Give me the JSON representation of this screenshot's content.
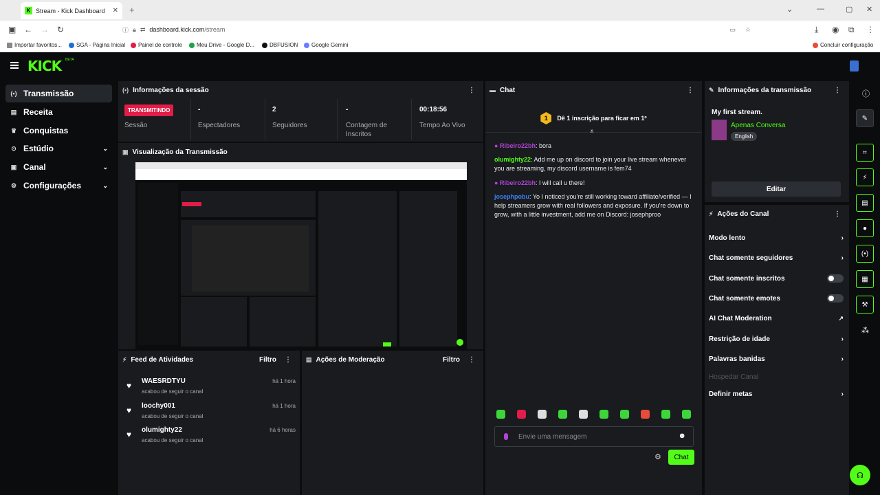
{
  "browser": {
    "tab_title": "Stream - Kick Dashboard",
    "url_host": "dashboard.kick.com",
    "url_path": "/stream",
    "bookmarks": [
      "Importar favoritos...",
      "SGA - Página Inicial",
      "Painel de controle",
      "Meu Drive - Google D...",
      "DBFUSION",
      "Google Gemini"
    ],
    "bookmark_right": "Concluir configuração"
  },
  "app": {
    "logo": "KICK",
    "beta": "BETA"
  },
  "sidebar": {
    "items": [
      {
        "label": "Transmissão",
        "icon": "broadcast-icon"
      },
      {
        "label": "Receita",
        "icon": "receipt-icon"
      },
      {
        "label": "Conquistas",
        "icon": "trophy-icon"
      },
      {
        "label": "Estúdio",
        "icon": "studio-icon"
      },
      {
        "label": "Canal",
        "icon": "channel-icon"
      },
      {
        "label": "Configurações",
        "icon": "gear-icon"
      }
    ]
  },
  "session": {
    "title": "Informações da sessão",
    "status": "TRANSMITINDO",
    "status_label": "Sessão",
    "viewers_value": "-",
    "viewers_label": "Espectadores",
    "followers_value": "2",
    "followers_label": "Seguidores",
    "subs_value": "-",
    "subs_label": "Contagem de Inscritos",
    "live_value": "00:18:56",
    "live_label": "Tempo Ao Vivo"
  },
  "preview": {
    "title": "Visualização da Transmissão"
  },
  "feed": {
    "title": "Feed de Atividades",
    "filter": "Filtro",
    "items": [
      {
        "name": "WAESRDTYU",
        "sub": "acabou de seguir o canal",
        "time": "há 1 hora"
      },
      {
        "name": "loochy001",
        "sub": "acabou de seguir o canal",
        "time": "há 1 hora"
      },
      {
        "name": "olumighty22",
        "sub": "acabou de seguir o canal",
        "time": "há 6 horas"
      }
    ]
  },
  "moderation": {
    "title": "Ações de Moderação",
    "filter": "Filtro"
  },
  "chat": {
    "title": "Chat",
    "cheer_number": "1",
    "cheer_text": "Dê 1 inscrição para ficar em 1º",
    "messages": [
      {
        "user": "Ribeiro22bh",
        "text": "bora",
        "color": "#b144d6"
      },
      {
        "user": "olumighty22",
        "text": "Add me up on discord to join your live stream whenever you are streaming, my discord username is fem74",
        "color": "#53fc18"
      },
      {
        "user": "Ribeiro22bh",
        "text": "I will call u there!",
        "color": "#b144d6"
      },
      {
        "user": "josephpobu",
        "text": "Yo I noticed you're still working toward affiliate/verified — I help streamers grow with real followers and exposure. If you're down to grow, with a little investment, add me on Discord: josephproo",
        "color": "#3b82f6"
      }
    ],
    "placeholder": "Envie uma mensagem",
    "send_label": "Chat"
  },
  "stream_info": {
    "title": "Informações da transmissão",
    "stream_title": "My first stream.",
    "category": "Apenas Conversa",
    "language": "English",
    "edit_label": "Editar"
  },
  "channel_actions": {
    "title": "Ações do Canal",
    "items": [
      {
        "label": "Modo lento",
        "control": "arrow"
      },
      {
        "label": "Chat somente seguidores",
        "control": "arrow"
      },
      {
        "label": "Chat somente inscritos",
        "control": "toggle"
      },
      {
        "label": "Chat somente emotes",
        "control": "toggle"
      },
      {
        "label": "AI Chat Moderation",
        "control": "external"
      },
      {
        "label": "Restrição de idade",
        "control": "arrow"
      },
      {
        "label": "Palavras banidas",
        "control": "arrow"
      },
      {
        "label": "Hospedar Canal",
        "control": "none"
      },
      {
        "label": "Definir metas",
        "control": "arrow"
      }
    ]
  },
  "colors": {
    "accent": "#53fc18",
    "live": "#e11d48",
    "panel": "#191b1f",
    "bg": "#0b0c0d"
  }
}
